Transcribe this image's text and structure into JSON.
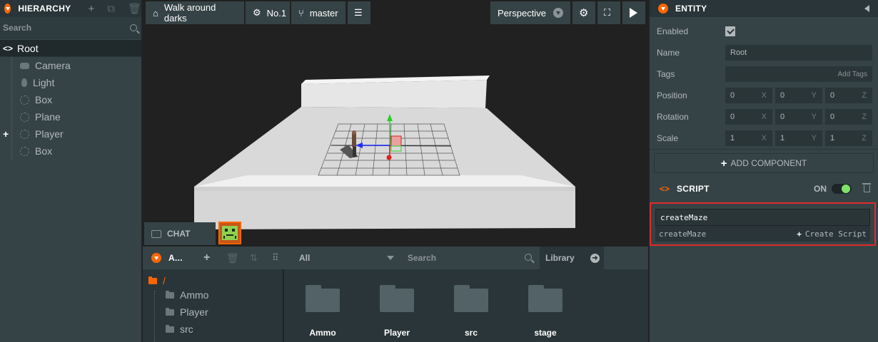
{
  "hierarchy": {
    "title": "HIERARCHY",
    "search_label": "Search",
    "root": {
      "label": "Root",
      "expander": "<>"
    },
    "items": [
      {
        "label": "Camera",
        "icon": "camera-icon"
      },
      {
        "label": "Light",
        "icon": "light-icon"
      },
      {
        "label": "Box",
        "icon": "entity-icon"
      },
      {
        "label": "Plane",
        "icon": "entity-icon"
      },
      {
        "label": "Player",
        "icon": "entity-icon",
        "collapsed": true
      },
      {
        "label": "Box",
        "icon": "entity-icon"
      }
    ]
  },
  "viewport": {
    "project": "Walk around darks",
    "build": "No.1",
    "branch": "master",
    "camera_mode": "Perspective",
    "chat": "CHAT"
  },
  "assets": {
    "title": "A...",
    "filter": "All",
    "search_placeholder": "Search",
    "library": "Library",
    "root_folder": "/",
    "tree": [
      "Ammo",
      "Player",
      "src"
    ],
    "grid": [
      "Ammo",
      "Player",
      "src",
      "stage"
    ]
  },
  "inspector": {
    "title": "ENTITY",
    "enabled_label": "Enabled",
    "enabled": true,
    "name_label": "Name",
    "name_value": "Root",
    "tags_label": "Tags",
    "tags_placeholder": "Add Tags",
    "position_label": "Position",
    "position": [
      "0",
      "0",
      "0"
    ],
    "rotation_label": "Rotation",
    "rotation": [
      "0",
      "0",
      "0"
    ],
    "scale_label": "Scale",
    "scale": [
      "1",
      "1",
      "1"
    ],
    "axes": [
      "X",
      "Y",
      "Z"
    ],
    "add_component": "ADD COMPONENT",
    "script": {
      "title": "SCRIPT",
      "state": "ON",
      "input_value": "createMaze",
      "suggestion": "createMaze",
      "create_label": "Create Script"
    }
  },
  "colors": {
    "accent": "#ff6600",
    "panel": "#364346",
    "panel_dark": "#293538",
    "highlight_border": "#e02b2b",
    "toggle_on": "#7fe36a"
  }
}
